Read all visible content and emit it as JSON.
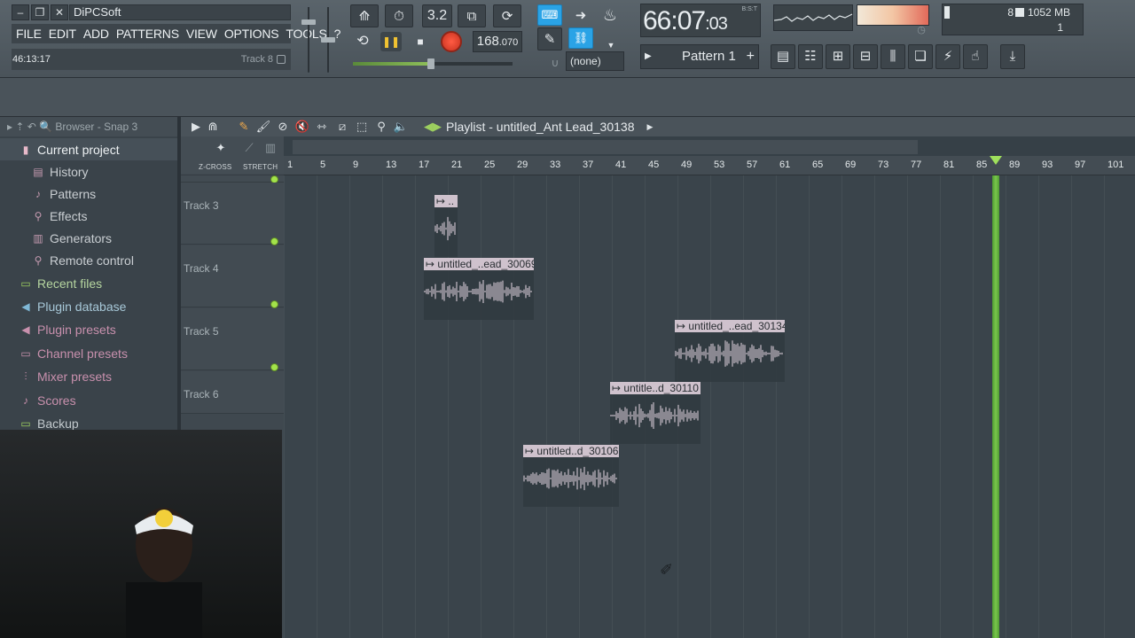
{
  "app": {
    "title": "DiPCSoft",
    "menu": [
      "FILE",
      "EDIT",
      "ADD",
      "PATTERNS",
      "VIEW",
      "OPTIONS",
      "TOOLS",
      "?"
    ],
    "hint_time": "46:13:17",
    "hint_track": "Track 8"
  },
  "transport": {
    "tempo_int": "168",
    "tempo_frac": ".070",
    "time_main": "66:07",
    "time_sub": ":03",
    "time_label": "B:S:T",
    "snap": "(none)",
    "pattern": "Pattern 1",
    "cpu": "8",
    "memory": "1052 MB",
    "polyphony": "1",
    "countdown": "3.2"
  },
  "browser": {
    "header": "Browser - Snap 3",
    "current": "Current project",
    "sub_items": [
      "History",
      "Patterns",
      "Effects",
      "Generators",
      "Remote control"
    ],
    "top_items": [
      "Recent files",
      "Plugin database",
      "Plugin presets",
      "Channel presets",
      "Mixer presets",
      "Scores",
      "Backup"
    ]
  },
  "playlist": {
    "title": "Playlist - untitled_Ant Lead_30138",
    "zcross": "Z-CROSS",
    "stretch": "STRETCH",
    "ruler": [
      "1",
      "5",
      "9",
      "13",
      "17",
      "21",
      "25",
      "29",
      "33",
      "37",
      "41",
      "45",
      "49",
      "53",
      "57",
      "61",
      "65",
      "69",
      "73",
      "77",
      "81",
      "85",
      "89",
      "93",
      "97",
      "101"
    ],
    "tracks": [
      "Track 3",
      "Track 4",
      "Track 5",
      "Track 6"
    ],
    "clips": [
      {
        "label": "↦ ..",
        "row": 0
      },
      {
        "label": "↦ untitled_..ead_30069",
        "row": 1
      },
      {
        "label": "↦ untitled_..ead_30134",
        "row": 2
      },
      {
        "label": "↦ untitle..d_30110",
        "row": 3
      },
      {
        "label": "↦ untitled..d_30106",
        "row": 4
      }
    ]
  },
  "icons": {
    "colors": {
      "accent_green": "#79c64c",
      "record_red": "#e0432e",
      "play_yellow": "#f1c232",
      "blue": "#2aa3e6",
      "clip_header": "#cfc2cd"
    }
  }
}
